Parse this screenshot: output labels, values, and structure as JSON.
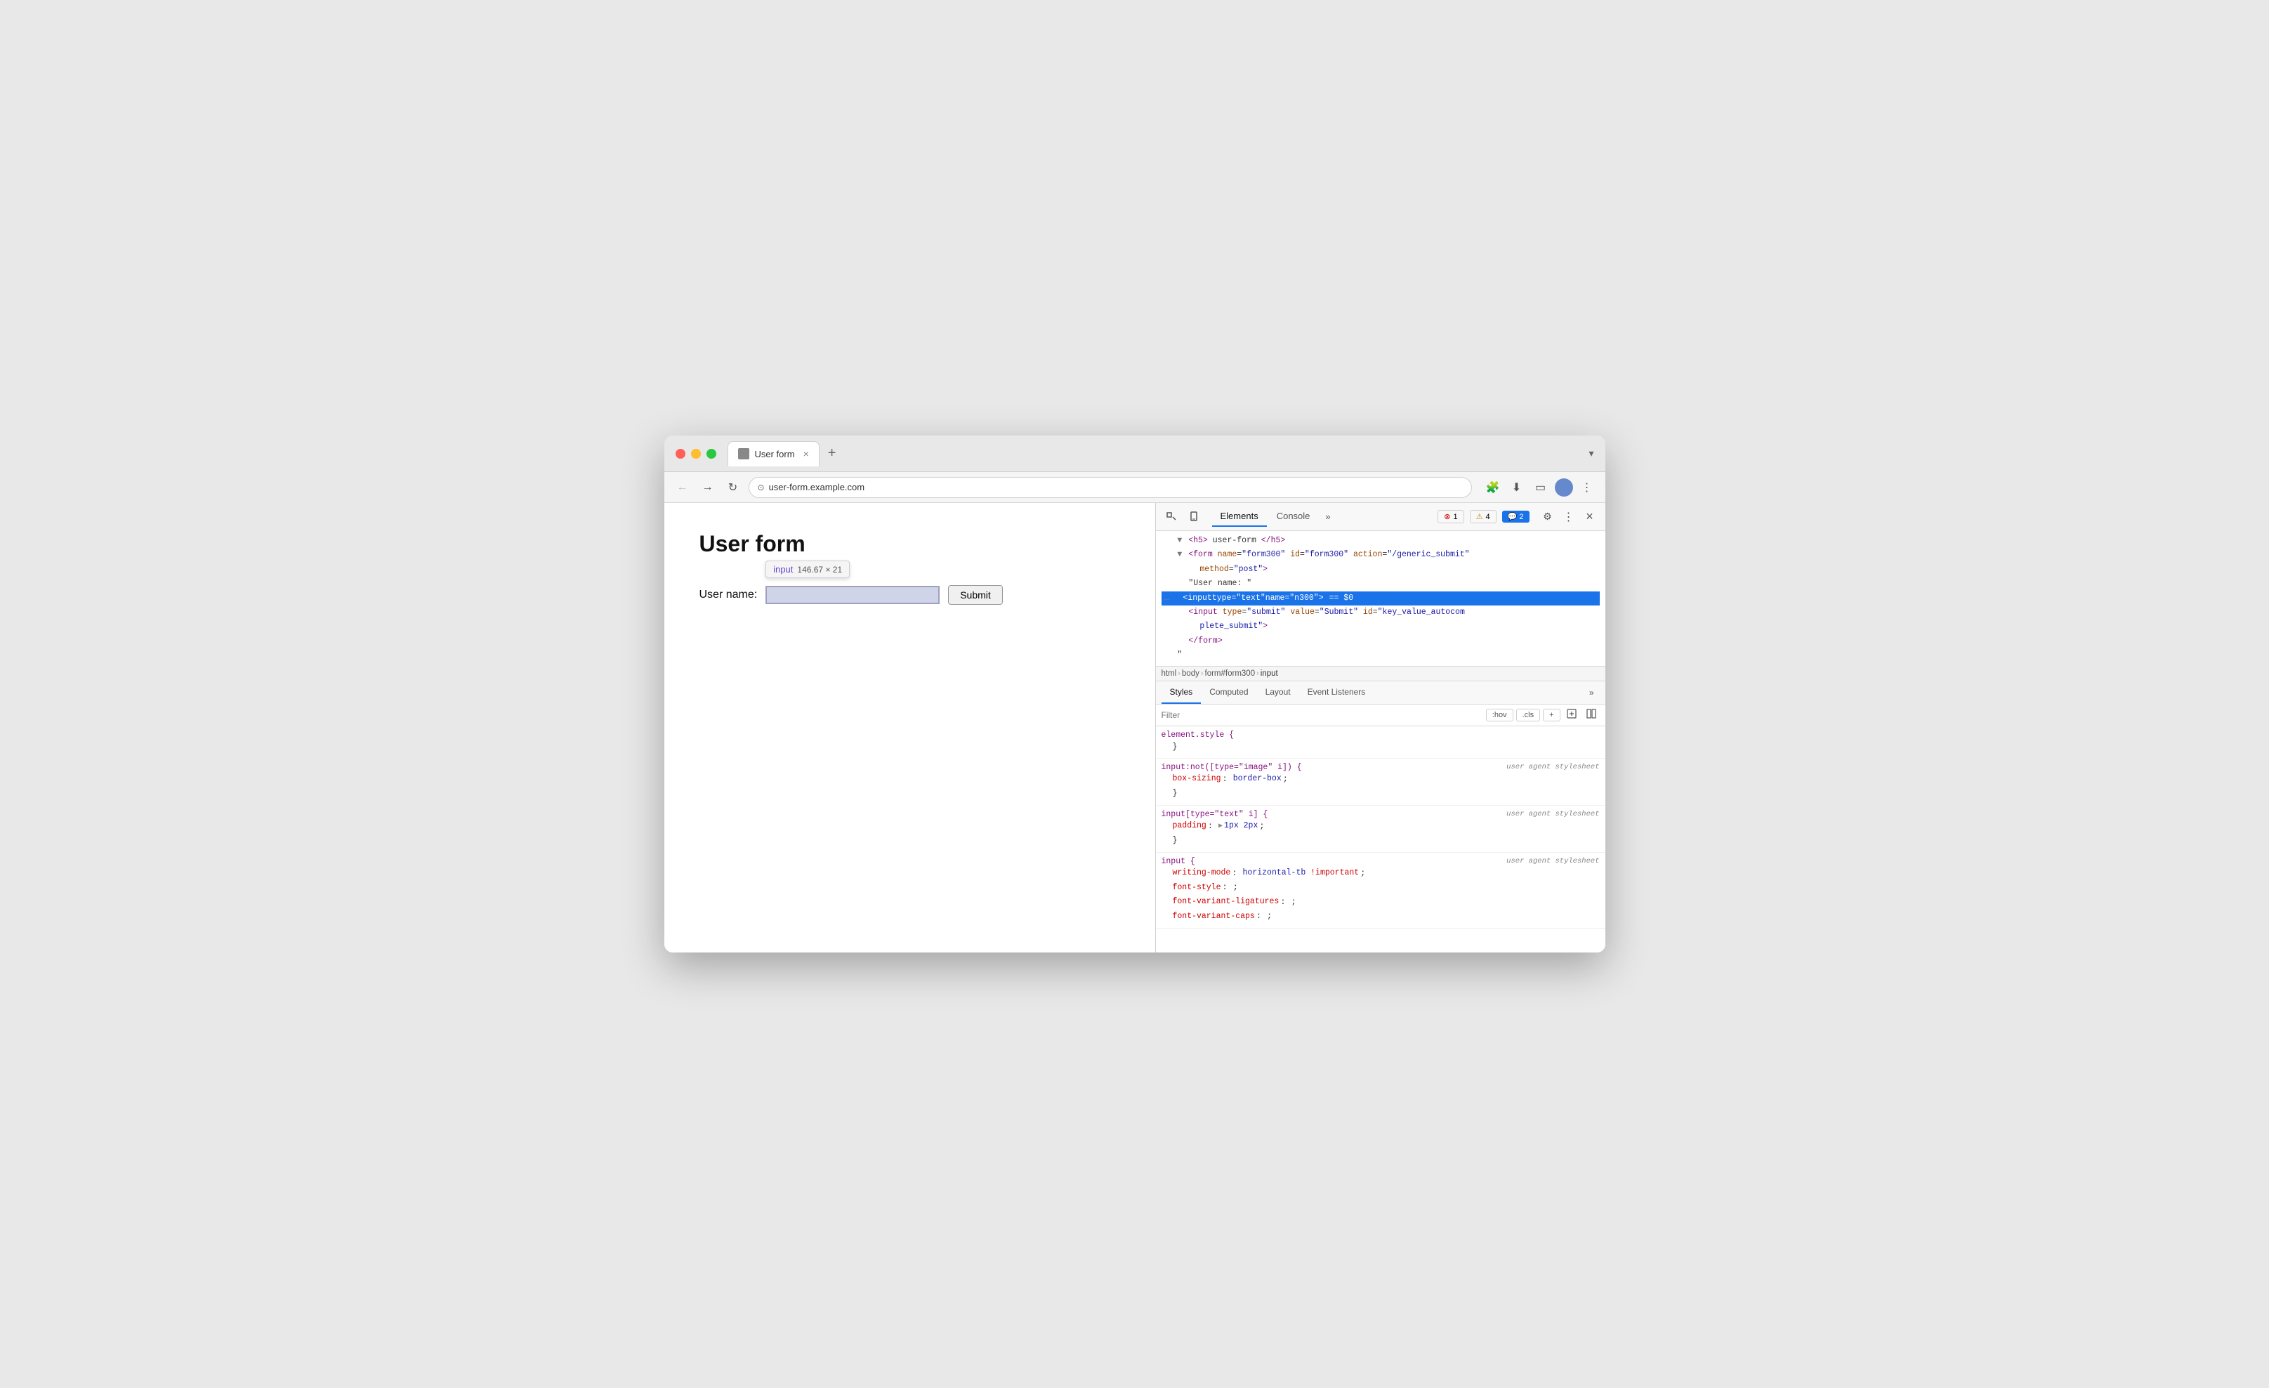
{
  "browser": {
    "tab_title": "User form",
    "tab_close": "×",
    "tab_new": "+",
    "dropdown": "▾",
    "back_btn": "←",
    "forward_btn": "→",
    "refresh_btn": "↻",
    "address": "user-form.example.com"
  },
  "webpage": {
    "title": "User form",
    "label": "User name:",
    "submit": "Submit",
    "tooltip_tag": "input",
    "tooltip_size": "146.67 × 21"
  },
  "devtools": {
    "tools": {
      "inspect": "⬚",
      "device": "📱"
    },
    "tabs": [
      "Elements",
      "Console"
    ],
    "more": "»",
    "badges": {
      "error": "1",
      "warning": "4",
      "message": "2"
    },
    "dom": {
      "line1": "<h5>user-form</h5>",
      "line2_tag": "form",
      "line2_attrs": [
        {
          "name": "name",
          "value": "\"form300\""
        },
        {
          "name": "id",
          "value": "\"form300\""
        },
        {
          "name": "action",
          "value": "\"/generic_submit\""
        }
      ],
      "line3_attr": "method=\"post\"",
      "line4_text": "\"User name: \"",
      "line5_tag": "input",
      "line5_attrs": [
        {
          "name": "type",
          "value": "\"text\""
        },
        {
          "name": "name",
          "value": "\"n300\""
        }
      ],
      "line5_suffix": "== $0",
      "line6_tag": "input",
      "line6_attrs": [
        {
          "name": "type",
          "value": "\"submit\""
        },
        {
          "name": "value",
          "value": "\"Submit\""
        },
        {
          "name": "id",
          "value": "\"key_value_autocom"
        }
      ],
      "line7": "plete_submit\">",
      "line8": "</form>",
      "line9": "\""
    },
    "breadcrumb": [
      "html",
      "body",
      "form#form300",
      "input"
    ],
    "styles_tabs": [
      "Styles",
      "Computed",
      "Layout",
      "Event Listeners"
    ],
    "styles_tabs_more": "»",
    "filter_placeholder": "Filter",
    "filter_hov": ":hov",
    "filter_cls": ".cls",
    "filter_plus": "+",
    "css_rules": [
      {
        "selector": "element.style {",
        "source": "",
        "close": "}",
        "properties": []
      },
      {
        "selector": "input:not([type=\"image\" i]) {",
        "source": "user agent stylesheet",
        "close": "}",
        "properties": [
          {
            "prop": "box-sizing",
            "value": "border-box",
            "colon": ":",
            "semi": ";"
          }
        ]
      },
      {
        "selector": "input[type=\"text\" i] {",
        "source": "user agent stylesheet",
        "close": "}",
        "properties": [
          {
            "prop": "padding",
            "value": "▶ 1px 2px",
            "colon": ":",
            "semi": ";",
            "has_triangle": true
          }
        ]
      },
      {
        "selector": "input {",
        "source": "user agent stylesheet",
        "close": "",
        "properties": [
          {
            "prop": "writing-mode",
            "value": "horizontal-tb !important",
            "colon": ":",
            "semi": ";"
          },
          {
            "prop": "font-style",
            "value": ";",
            "colon": ":",
            "semi": "",
            "empty": true
          },
          {
            "prop": "font-variant-ligatures",
            "value": ";",
            "colon": ":",
            "semi": "",
            "empty": true
          },
          {
            "prop": "font-variant-caps",
            "value": ";",
            "colon": ":",
            "semi": "",
            "empty": true
          }
        ]
      }
    ]
  }
}
